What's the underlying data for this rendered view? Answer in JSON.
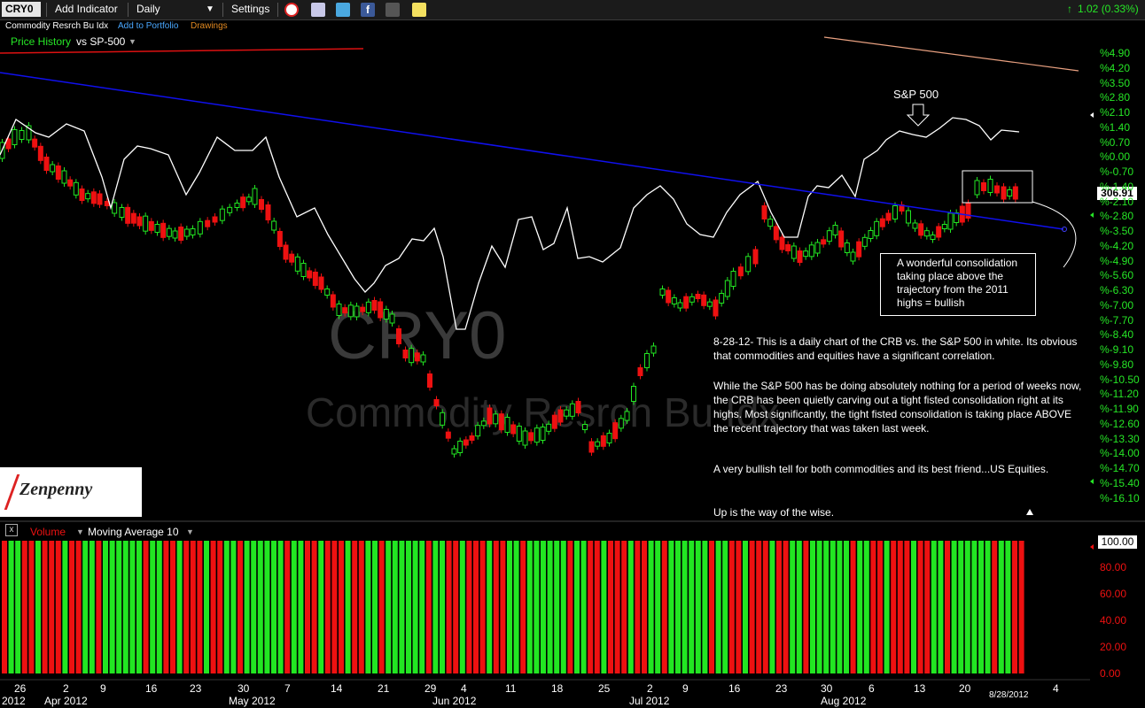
{
  "toolbar": {
    "symbol": "CRY0",
    "add_indicator": "Add Indicator",
    "interval": "Daily",
    "settings": "Settings",
    "change": "1.02 (0.33%)"
  },
  "subheader": {
    "name": "Commodity Resrch Bu Idx",
    "add_portfolio": "Add to Portfolio",
    "drawings": "Drawings"
  },
  "price_panel": {
    "label": "Price History",
    "vs": "vs SP-500",
    "watermark_symbol": "CRY0",
    "watermark_name": "Commodity Resrch Bu Idx",
    "last_price": "306.91",
    "sp_annotation": "S&P 500",
    "logo_text": "Zenpenny"
  },
  "callout": "A wonderful consolidation taking place above the trajectory from the 2011 highs = bullish",
  "commentary": [
    "8-28-12- This is a daily chart of the CRB vs. the S&P 500 in white. Its obvious that commodities and equities have a significant correlation.",
    "While the S&P 500 has be doing absolutely nothing for a period of weeks now, the CRB has been quietly carving out a tight fisted consolidation right at its highs. Most significantly, the tight fisted consolidation is taking place ABOVE the recent trajectory that was taken last week.",
    "A very bullish tell for both commodities and its best friend...US Equities.",
    "Up is the way of the wise."
  ],
  "y_axis_labels": [
    "%4.90",
    "%4.20",
    "%3.50",
    "%2.80",
    "%2.10",
    "%1.40",
    "%0.70",
    "%0.00",
    "%-0.70",
    "%-1.40",
    "%-2.10",
    "%-2.80",
    "%-3.50",
    "%-4.20",
    "%-4.90",
    "%-5.60",
    "%-6.30",
    "%-7.00",
    "%-7.70",
    "%-8.40",
    "%-9.10",
    "%-9.80",
    "%-10.50",
    "%-11.20",
    "%-11.90",
    "%-12.60",
    "%-13.30",
    "%-14.00",
    "%-14.70",
    "%-15.40",
    "%-16.10"
  ],
  "volume_panel": {
    "label": "Volume",
    "ma": "Moving Average 10",
    "top_value": "100.00",
    "axis_labels": [
      "80.00",
      "60.00",
      "40.00",
      "20.00",
      "0.00"
    ]
  },
  "x_axis": {
    "days": [
      "26",
      "2",
      "9",
      "16",
      "23",
      "30",
      "7",
      "14",
      "21",
      "29",
      "4",
      "11",
      "18",
      "25",
      "2",
      "9",
      "16",
      "23",
      "30",
      "6",
      "13",
      "20",
      "4"
    ],
    "months": [
      "2012",
      "Apr 2012",
      "May 2012",
      "Jun 2012",
      "Jul 2012",
      "Aug 2012"
    ],
    "cursor_date": "8/28/2012"
  },
  "colors": {
    "up": "#22e622",
    "down": "#ee1111",
    "trendline": "#1010ee",
    "sp500": "#ffffff",
    "axis_green": "#26e626"
  }
}
